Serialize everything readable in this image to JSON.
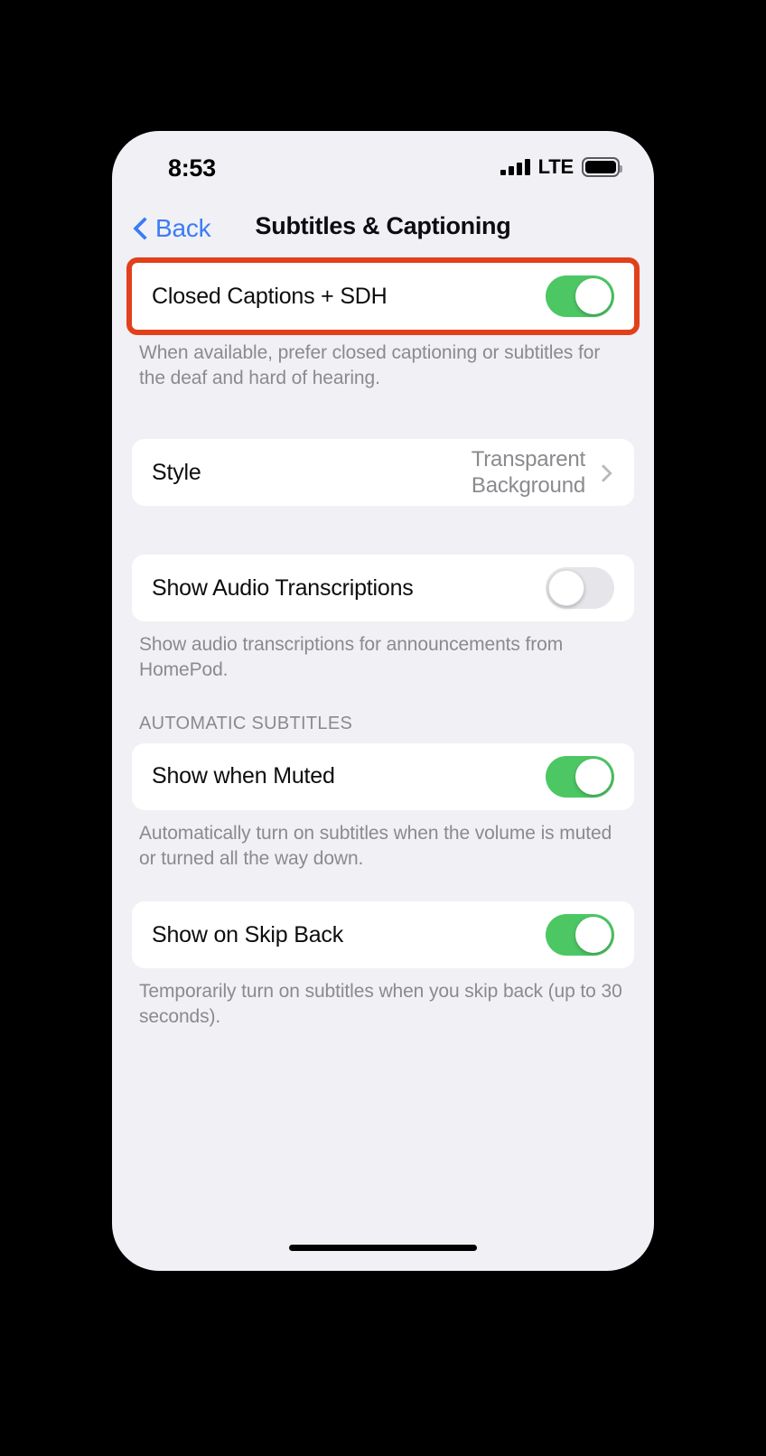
{
  "status_bar": {
    "time": "8:53",
    "carrier_label": "LTE",
    "signal_icon": "cellular-signal-icon",
    "battery_icon": "battery-icon"
  },
  "nav": {
    "back_label": "Back",
    "back_icon": "chevron-left-icon",
    "title": "Subtitles & Captioning"
  },
  "colors": {
    "highlight": "#e2401b",
    "toggle_on": "#4cc764",
    "toggle_off": "#e6e6ea",
    "accent_blue": "#3b7cf6",
    "page_background": "#f1f0f5",
    "card_background": "#ffffff",
    "secondary_text": "#8a8a8f"
  },
  "sections": [
    {
      "rows": [
        {
          "label": "Closed Captions + SDH",
          "control": "toggle",
          "state": "on",
          "highlighted": true
        }
      ],
      "footer": "When available, prefer closed captioning or subtitles for the deaf and hard of hearing."
    },
    {
      "rows": [
        {
          "label": "Style",
          "control": "disclosure",
          "value": "Transparent Background"
        }
      ],
      "footer": ""
    },
    {
      "rows": [
        {
          "label": "Show Audio Transcriptions",
          "control": "toggle",
          "state": "off"
        }
      ],
      "footer": "Show audio transcriptions for announcements from HomePod."
    },
    {
      "header": "AUTOMATIC SUBTITLES",
      "rows": [
        {
          "label": "Show when Muted",
          "control": "toggle",
          "state": "on"
        }
      ],
      "footer": "Automatically turn on subtitles when the volume is muted or turned all the way down."
    },
    {
      "rows": [
        {
          "label": "Show on Skip Back",
          "control": "toggle",
          "state": "on"
        }
      ],
      "footer": "Temporarily turn on subtitles when you skip back (up to 30 seconds)."
    }
  ]
}
